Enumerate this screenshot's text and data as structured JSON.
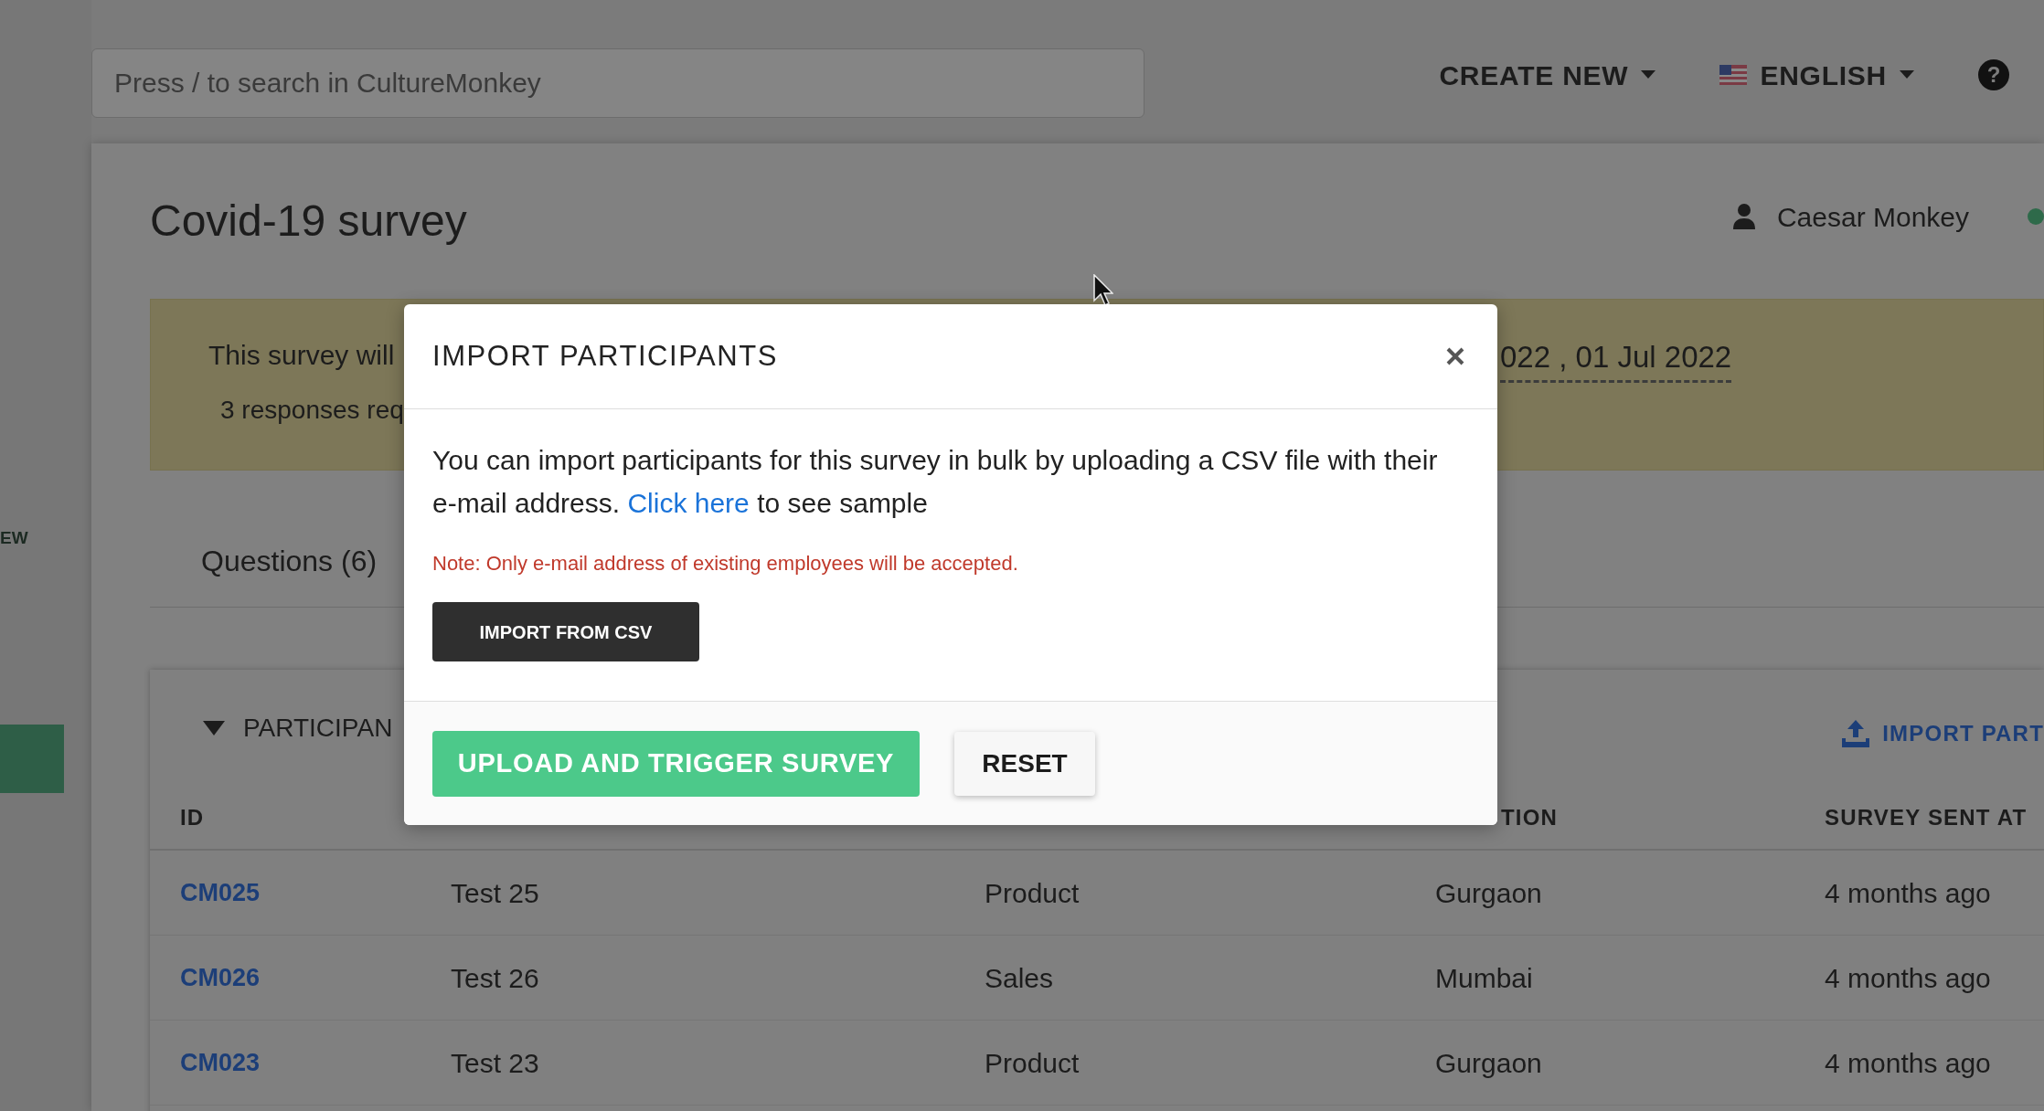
{
  "search": {
    "placeholder": "Press / to search in CultureMonkey"
  },
  "header_menu": [
    {
      "label": "CREATE NEW",
      "kind": "dropdown"
    },
    {
      "label": "ENGLISH",
      "kind": "language"
    }
  ],
  "help": {
    "label": "?"
  },
  "sidebar": {
    "items": [
      {
        "label": "EW",
        "selected": false
      },
      {
        "selected": true
      }
    ]
  },
  "page": {
    "title": "Covid-19 survey",
    "user": "Caesar Monkey",
    "online": true
  },
  "banner": {
    "line_1": "This survey will",
    "dates": "022 , 01 Jul 2022",
    "line_2": "3 responses req"
  },
  "tabs": [
    {
      "label": "Questions (6)",
      "selected": false
    }
  ],
  "participants": {
    "title": "PARTICIPAN",
    "expanded": true,
    "action": "IMPORT PART",
    "columns": [
      "ID",
      null,
      null,
      "TION",
      "SURVEY SENT AT"
    ],
    "rows": [
      {
        "cells": [
          "CM025",
          "Test 25",
          "Product",
          "Gurgaon",
          "4 months ago"
        ]
      },
      {
        "cells": [
          "CM026",
          "Test 26",
          "Sales",
          "Mumbai",
          "4 months ago"
        ]
      },
      {
        "cells": [
          "CM023",
          "Test 23",
          "Product",
          "Gurgaon",
          "4 months ago"
        ]
      }
    ]
  },
  "modal": {
    "title": "IMPORT PARTICIPANTS",
    "body_text": "You can import participants for this survey in bulk by uploading a CSV file with their e-mail address.",
    "link": "Click here",
    "body_after": "to see sample",
    "note": "Note: Only e-mail address of existing employees will be accepted.",
    "buttons": [
      {
        "label": "IMPORT FROM CSV",
        "kind": "dark"
      },
      {
        "label": "UPLOAD AND TRIGGER SURVEY",
        "kind": "primary"
      },
      {
        "label": "RESET",
        "kind": "light"
      }
    ]
  }
}
